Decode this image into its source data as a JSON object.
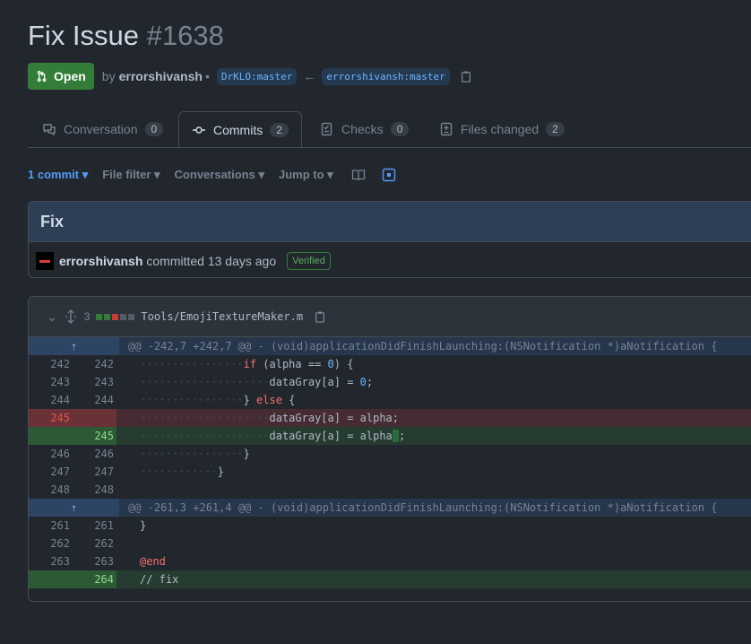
{
  "pr": {
    "title": "Fix Issue",
    "number": "#1638",
    "state": "Open",
    "by": "by",
    "author": "errorshivansh",
    "separator": "•",
    "base_branch": "DrKLO:master",
    "head_branch": "errorshivansh:master"
  },
  "tabs": [
    {
      "label": "Conversation",
      "count": "0"
    },
    {
      "label": "Commits",
      "count": "2"
    },
    {
      "label": "Checks",
      "count": "0"
    },
    {
      "label": "Files changed",
      "count": "2"
    }
  ],
  "toolbar": {
    "commit_select": "1 commit",
    "file_filter": "File filter",
    "conversations": "Conversations",
    "jump_to": "Jump to"
  },
  "commit": {
    "message": "Fix",
    "author": "errorshivansh",
    "action": "committed 13 days ago",
    "verified": "Verified"
  },
  "file": {
    "changes": "3",
    "path": "Tools/EmojiTextureMaker.m",
    "diffstat_colors": [
      "#347d39",
      "#347d39",
      "#c93c37",
      "#545d68",
      "#545d68"
    ]
  },
  "diff": {
    "hunk1": "@@ -242,7 +242,7 @@ - (void)applicationDidFinishLaunching:(NSNotification *)aNotification {",
    "hunk2": "@@ -261,3 +261,4 @@ - (void)applicationDidFinishLaunching:(NSNotification *)aNotification {",
    "lines": [
      {
        "old": "242",
        "new": "242",
        "dots": "················",
        "k": "if",
        "t": " (alpha == ",
        "n": "0",
        "e": ") {"
      },
      {
        "old": "243",
        "new": "243",
        "dots": "····················",
        "t": "dataGray[a] = ",
        "n": "0",
        "e": ";"
      },
      {
        "old": "244",
        "new": "244",
        "dots": "················",
        "t": "} ",
        "k": "else",
        "e": " {"
      },
      {
        "old": "245",
        "new": "",
        "dots": "····················",
        "t": "dataGray[a] = alpha;"
      },
      {
        "old": "",
        "new": "245",
        "dots": "····················",
        "t": "dataGray[a] = alpha",
        "h": " ",
        "e": ";"
      },
      {
        "old": "246",
        "new": "246",
        "dots": "················",
        "t": "}"
      },
      {
        "old": "247",
        "new": "247",
        "dots": "············",
        "t": "}"
      },
      {
        "old": "248",
        "new": "248",
        "t": ""
      },
      {
        "old": "261",
        "new": "261",
        "t": "}"
      },
      {
        "old": "262",
        "new": "262",
        "t": ""
      },
      {
        "old": "263",
        "new": "263",
        "k": "@end"
      },
      {
        "old": "",
        "new": "264",
        "t": "// fix"
      }
    ]
  }
}
